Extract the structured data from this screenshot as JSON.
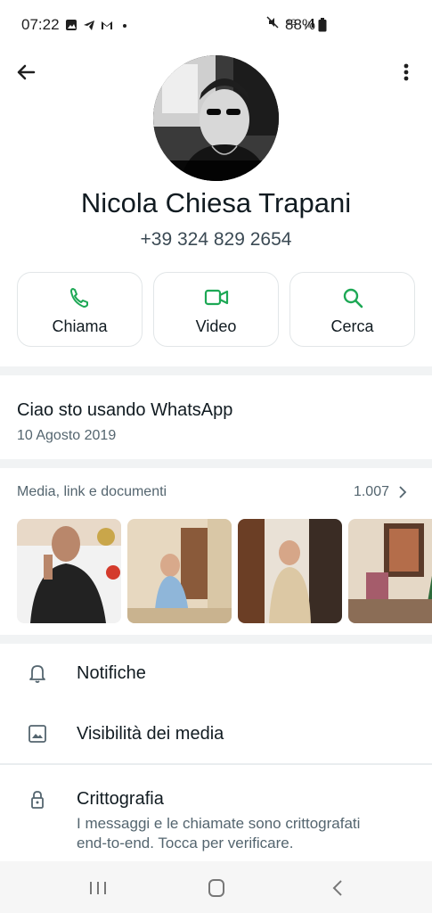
{
  "status_bar": {
    "time": "07:22",
    "battery": "88%",
    "network": "4G",
    "left_icons": [
      "gallery-icon",
      "telegram-icon",
      "gmail-icon",
      "dot-icon"
    ],
    "right_icons": [
      "mute-icon",
      "network-4g-icon",
      "signal-icon",
      "battery-icon"
    ]
  },
  "contact": {
    "name": "Nicola Chiesa Trapani",
    "phone": "+39 324 829 2654"
  },
  "actions": [
    {
      "label": "Chiama",
      "icon": "phone-icon"
    },
    {
      "label": "Video",
      "icon": "video-icon"
    },
    {
      "label": "Cerca",
      "icon": "search-icon"
    }
  ],
  "about": {
    "text": "Ciao sto usando WhatsApp",
    "date": "10 Agosto 2019"
  },
  "media": {
    "header": "Media, link e documenti",
    "count": "1.007"
  },
  "settings": {
    "notifications": "Notifiche",
    "media_visibility": "Visibilità dei media",
    "encryption_title": "Crittografia",
    "encryption_desc": "I messaggi e le chiamate sono crittografati end-to-end. Tocca per verificare."
  },
  "colors": {
    "accent": "#1da855",
    "text": "#111b21",
    "secondary": "#54656f",
    "divider": "#f1f3f4"
  }
}
